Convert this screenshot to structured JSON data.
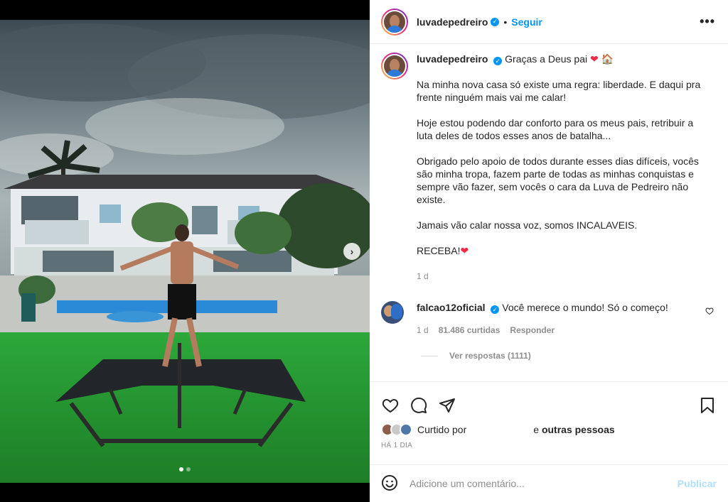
{
  "post": {
    "username": "luvadepedreiro",
    "follow_label": "Seguir",
    "separator": "•",
    "more_label": "•••",
    "verified_icon": "verified-badge-icon",
    "accent_color": "#0095f6"
  },
  "caption": {
    "username": "luvadepedreiro",
    "first_line": "Graças a Deus pai",
    "first_line_emojis": [
      "❤",
      "🏠"
    ],
    "paragraphs": [
      "Na minha nova casa só existe uma regra: liberdade. E daqui pra frente ninguém mais vai me calar!",
      "Hoje estou podendo dar conforto para os meus pais, retribuir a luta deles de todos esses anos de batalha...",
      "Obrigado pelo apoio de todos durante esses dias difíceis, vocês são minha tropa, fazem parte de todas as minhas conquistas e sempre vão fazer, sem vocês o cara da Luva de Pedreiro não existe.",
      "Jamais vão calar nossa voz, somos INCALAVEIS."
    ],
    "last_line": "RECEBA!",
    "last_line_emoji": "❤",
    "time": "1 d"
  },
  "comment": {
    "username": "falcao12oficial",
    "text": "Você merece o mundo! Só o começo!",
    "time": "1 d",
    "likes": "81.486 curtidas",
    "reply_label": "Responder",
    "view_replies": "Ver respostas (1111)"
  },
  "actions": {
    "liked_by_label": "Curtido por",
    "others_prefix": "e",
    "others_label": "outras pessoas",
    "posted_time": "HÁ 1 DIA"
  },
  "composer": {
    "placeholder": "Adicione um comentário...",
    "publish_label": "Publicar"
  },
  "media": {
    "next_label": "›",
    "slides": 2,
    "active_slide": 1
  }
}
